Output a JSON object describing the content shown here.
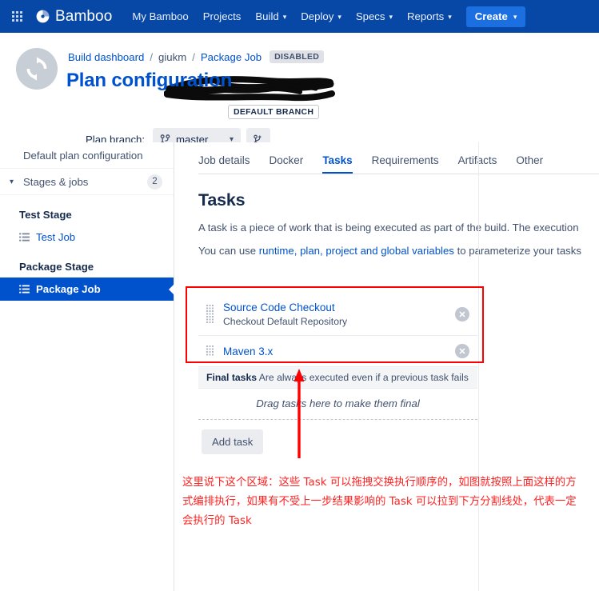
{
  "topnav": {
    "app_switcher_icon": "grid-apps-icon",
    "brand": "Bamboo",
    "brand_logo_icon": "bamboo-logo-icon",
    "items": [
      {
        "label": "My Bamboo",
        "has_caret": false
      },
      {
        "label": "Projects",
        "has_caret": false
      },
      {
        "label": "Build",
        "has_caret": true
      },
      {
        "label": "Deploy",
        "has_caret": true
      },
      {
        "label": "Specs",
        "has_caret": true
      },
      {
        "label": "Reports",
        "has_caret": true
      }
    ],
    "create_label": "Create",
    "caret_glyph": "▾"
  },
  "header": {
    "avatar_icon": "sync-refresh-icon",
    "breadcrumb": {
      "root": "Build dashboard",
      "separator": "/",
      "redacted_plan": "giukm",
      "job": "Package Job",
      "status_badge": "DISABLED"
    },
    "title": "Plan configuration",
    "branch_badge": "DEFAULT BRANCH",
    "branch_row": {
      "label": "Plan branch:",
      "selected_branch": "master",
      "branch_icon": "branch-fork-icon",
      "caret_glyph": "▾",
      "add_branch_icon": "add-branch-icon"
    }
  },
  "sidebar": {
    "default_config_label": "Default plan configuration",
    "stages_label": "Stages & jobs",
    "stages_count": "2",
    "chevron_glyph": "▾",
    "groups": [
      {
        "stage": "Test Stage",
        "jobs": [
          {
            "label": "Test Job",
            "active": false,
            "icon": "job-list-icon"
          }
        ]
      },
      {
        "stage": "Package Stage",
        "jobs": [
          {
            "label": "Package Job",
            "active": true,
            "icon": "job-list-icon"
          }
        ]
      }
    ]
  },
  "main": {
    "tabs": [
      {
        "label": "Job details",
        "active": false
      },
      {
        "label": "Docker",
        "active": false
      },
      {
        "label": "Tasks",
        "active": true
      },
      {
        "label": "Requirements",
        "active": false
      },
      {
        "label": "Artifacts",
        "active": false
      },
      {
        "label": "Other",
        "active": false
      }
    ],
    "heading": "Tasks",
    "description": "A task is a piece of work that is being executed as part of the build. The execution",
    "variables_line": {
      "prefix": "You can use ",
      "link": "runtime, plan, project and global variables",
      "suffix": " to parameterize your tasks"
    },
    "tasks": [
      {
        "title": "Source Code Checkout",
        "subtitle": "Checkout Default Repository",
        "grip_icon": "drag-handle-icon",
        "delete_icon": "remove-circle-icon"
      },
      {
        "title": "Maven 3.x",
        "subtitle": "",
        "grip_icon": "drag-handle-icon",
        "delete_icon": "remove-circle-icon"
      }
    ],
    "final_tasks": {
      "title": "Final tasks",
      "description": "Are always executed even if a previous task fails",
      "dropzone_text": "Drag tasks here to make them final"
    },
    "add_task_label": "Add task"
  },
  "annotations": {
    "highlight_box_color": "#FF0000",
    "arrow_color": "#FF0000",
    "text_color": "#FF2222",
    "note": "这里说下这个区域：这些 Task 可以拖拽交换执行顺序的，如图就按照上面这样的方式编排执行，如果有不受上一步结果影响的 Task 可以拉到下方分割线处，代表一定会执行的 Task"
  },
  "colors": {
    "nav_blue": "#0747A6",
    "link_blue": "#0052CC",
    "create_blue": "#1B6FE0",
    "text_dark": "#172B4D",
    "text_muted": "#42526E",
    "border": "#DFE1E6"
  }
}
